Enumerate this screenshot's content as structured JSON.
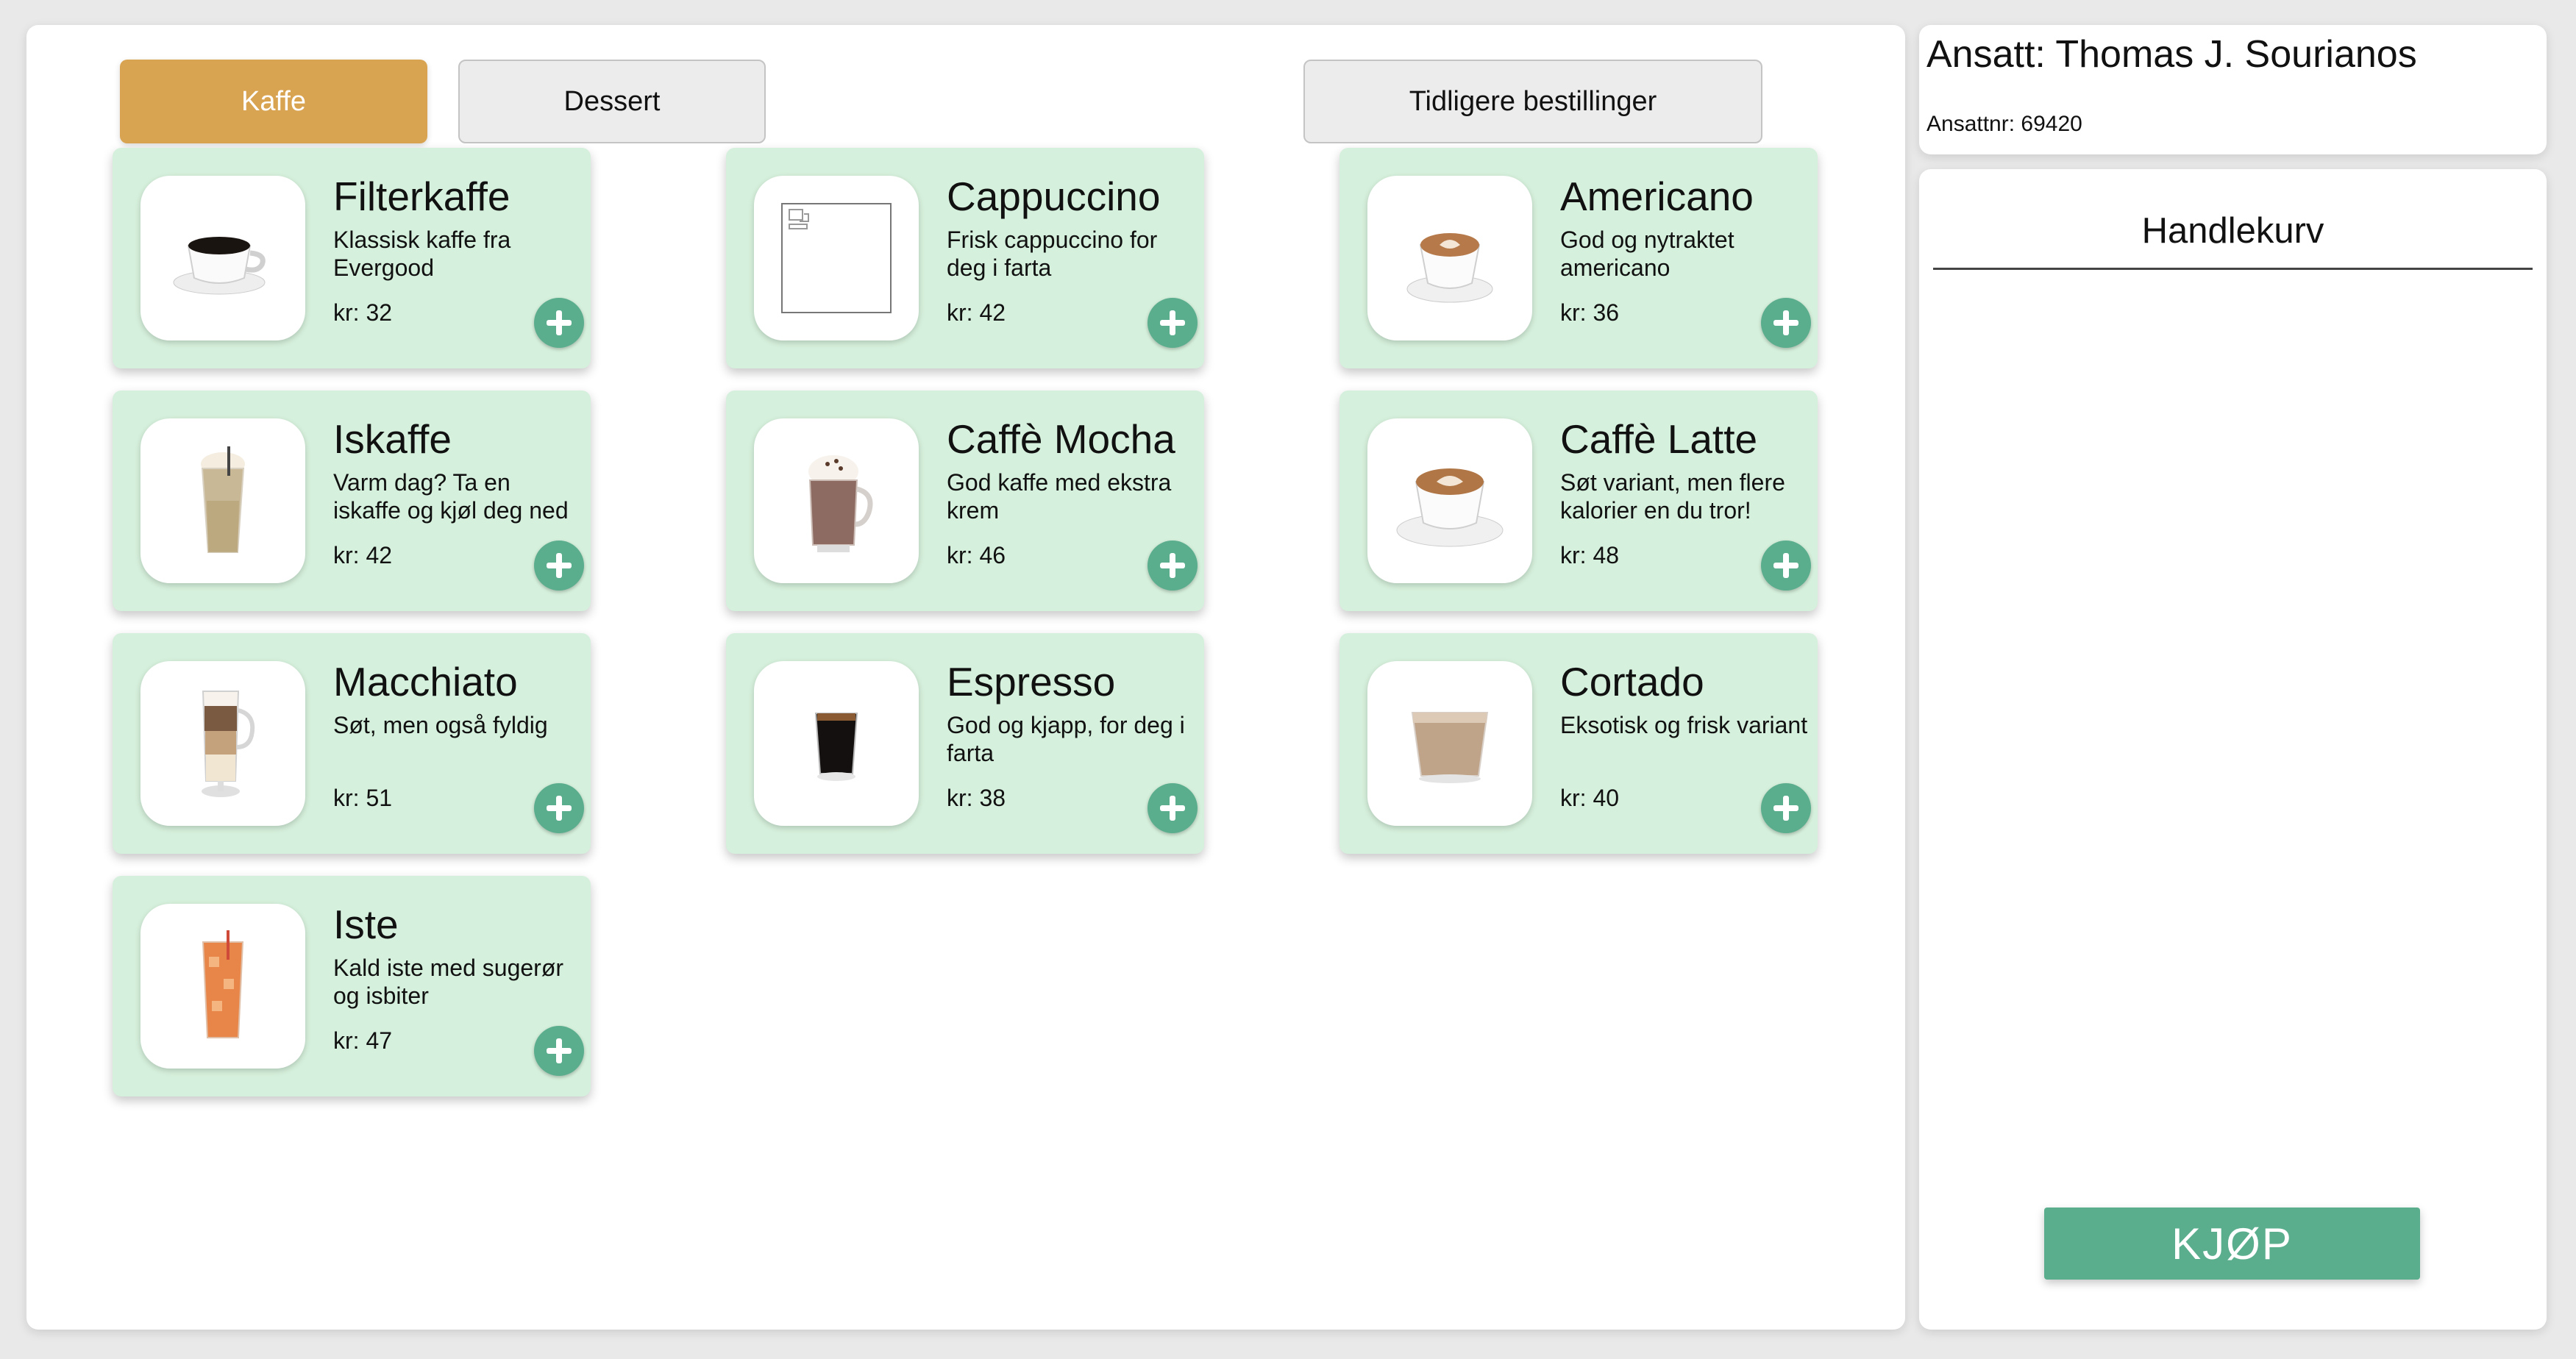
{
  "tabs": {
    "coffee_label": "Kaffe",
    "dessert_label": "Dessert",
    "history_label": "Tidligere bestillinger"
  },
  "colors": {
    "accent": "#d9a451",
    "card_bg": "#d5f0dc",
    "button_green": "#5aae8e"
  },
  "products": [
    {
      "name": "Filterkaffe",
      "desc": "Klassisk kaffe fra Evergood",
      "price": "kr: 32",
      "icon": "black-coffee-cup-icon"
    },
    {
      "name": "Cappuccino",
      "desc": "Frisk cappuccino for deg i farta",
      "price": "kr: 42",
      "icon": "broken-image-icon"
    },
    {
      "name": "Americano",
      "desc": "God og nytraktet americano",
      "price": "kr: 36",
      "icon": "latte-art-cup-icon"
    },
    {
      "name": "Iskaffe",
      "desc": "Varm dag? Ta en iskaffe og kjøl deg ned",
      "price": "kr: 42",
      "icon": "iced-coffee-glass-icon"
    },
    {
      "name": "Caffè Mocha",
      "desc": "God kaffe med ekstra krem",
      "price": "kr: 46",
      "icon": "mocha-glass-icon"
    },
    {
      "name": "Caffè Latte",
      "desc": "Søt variant, men flere kalorier en du tror!",
      "price": "kr: 48",
      "icon": "latte-cup-icon"
    },
    {
      "name": "Macchiato",
      "desc": "Søt, men også fyldig",
      "price": "kr: 51",
      "icon": "layered-macchiato-glass-icon"
    },
    {
      "name": "Espresso",
      "desc": "God og kjapp, for deg i farta",
      "price": "kr: 38",
      "icon": "espresso-glass-icon"
    },
    {
      "name": "Cortado",
      "desc": "Eksotisk og frisk variant",
      "price": "kr: 40",
      "icon": "cortado-glass-icon"
    },
    {
      "name": "Iste",
      "desc": "Kald iste med sugerør og isbiter",
      "price": "kr: 47",
      "icon": "iced-tea-glass-icon"
    }
  ],
  "employee": {
    "name": "Ansatt: Thomas J. Sourianos",
    "number": "Ansattnr: 69420"
  },
  "cart": {
    "title": "Handlekurv",
    "buy_label": "KJØP"
  }
}
